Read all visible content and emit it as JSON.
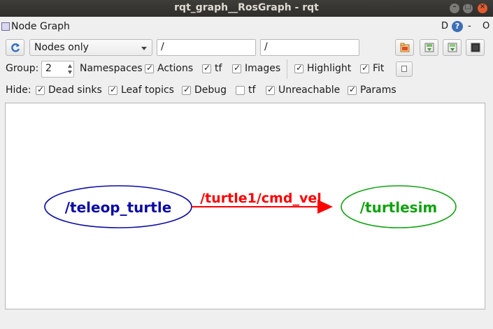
{
  "window": {
    "title": "rqt_graph__RosGraph - rqt"
  },
  "plugin": {
    "title": "Node Graph",
    "d_label": "D",
    "help_label": "?",
    "dash_label": "-",
    "o_label": "O"
  },
  "toolbar": {
    "mode": "Nodes only",
    "namespace_filter": "/",
    "topic_filter": "/"
  },
  "options": {
    "group_label": "Group:",
    "group_value": "2",
    "namespaces_label": "Namespaces",
    "items": [
      {
        "label": "Actions",
        "checked": true
      },
      {
        "label": "tf",
        "checked": true
      },
      {
        "label": "Images",
        "checked": true
      },
      {
        "label": "Highlight",
        "checked": true
      },
      {
        "label": "Fit",
        "checked": true
      }
    ]
  },
  "hide": {
    "label": "Hide:",
    "items": [
      {
        "label": "Dead sinks",
        "checked": true
      },
      {
        "label": "Leaf topics",
        "checked": true
      },
      {
        "label": "Debug",
        "checked": true
      },
      {
        "label": "tf",
        "checked": false
      },
      {
        "label": "Unreachable",
        "checked": true
      },
      {
        "label": "Params",
        "checked": true
      }
    ]
  },
  "graph": {
    "nodes": [
      {
        "name": "/teleop_turtle",
        "color": "#0a0aa6"
      },
      {
        "name": "/turtlesim",
        "color": "#0ea20e"
      }
    ],
    "edge": {
      "label": "/turtle1/cmd_vel",
      "color": "#ff0000"
    }
  },
  "colors": {
    "titlebar": "#2f2e2b",
    "close": "#e45a2e",
    "icon_blue": "#3d6fb8"
  }
}
